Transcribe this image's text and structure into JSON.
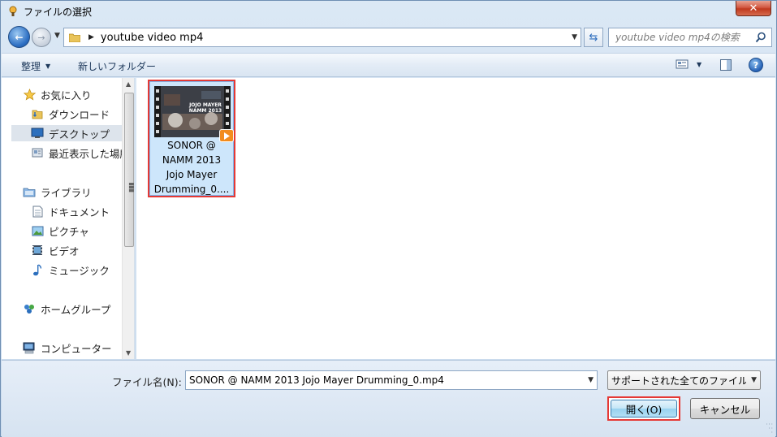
{
  "window": {
    "title": "ファイルの選択"
  },
  "address": {
    "path": "youtube video mp4"
  },
  "search": {
    "placeholder": "youtube video mp4の検索"
  },
  "toolbar": {
    "organize_label": "整理",
    "new_folder_label": "新しいフォルダー"
  },
  "nav": {
    "favorites": {
      "label": "お気に入り"
    },
    "items": [
      {
        "label": "ダウンロード"
      },
      {
        "label": "デスクトップ"
      },
      {
        "label": "最近表示した場所"
      }
    ],
    "libraries": {
      "label": "ライブラリ"
    },
    "library_items": [
      {
        "label": "ドキュメント"
      },
      {
        "label": "ピクチャ"
      },
      {
        "label": "ビデオ"
      },
      {
        "label": "ミュージック"
      }
    ],
    "homegroup": {
      "label": "ホームグループ"
    },
    "computer": {
      "label": "コンピューター"
    }
  },
  "files": [
    {
      "name_lines": [
        "SONOR @",
        "NAMM 2013",
        "Jojo Mayer",
        "Drumming_0...."
      ],
      "thumb_text": "JOJO MAYER NAMM 2013"
    }
  ],
  "footer": {
    "filename_label": "ファイル名(N):",
    "filename_value": "SONOR @ NAMM 2013 Jojo Mayer Drumming_0.mp4",
    "filter_value": "サポートされた全てのファイル",
    "open_label": "開く(O)",
    "cancel_label": "キャンセル"
  },
  "colors": {
    "selection": "#cde6fb",
    "highlight_border": "#e53935",
    "accent": "#2d6fc3"
  }
}
